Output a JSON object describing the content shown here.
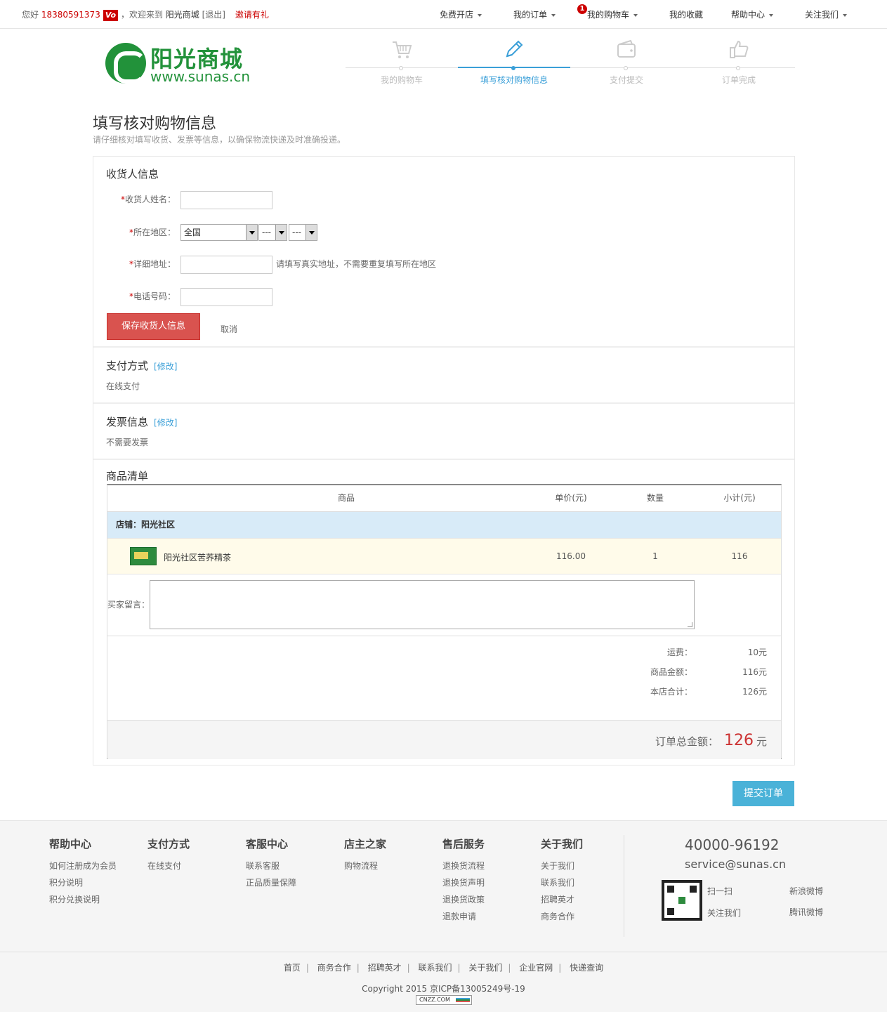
{
  "topbar": {
    "greeting": "您好",
    "phone": "18380591373",
    "vip_badge": "Vo",
    "welcome": "，欢迎来到",
    "site_name": "阳光商城",
    "logout": "[退出]",
    "invite": "邀请有礼",
    "nav": [
      {
        "label": "免费开店",
        "caret": true
      },
      {
        "label": "我的订单",
        "caret": true
      },
      {
        "label": "我的购物车",
        "caret": true,
        "badge": "1"
      },
      {
        "label": "我的收藏",
        "caret": false
      },
      {
        "label": "帮助中心",
        "caret": true
      },
      {
        "label": "关注我们",
        "caret": true
      }
    ]
  },
  "logo": {
    "zh": "阳光商城",
    "en": "www.sunas.cn"
  },
  "steps": [
    {
      "label": "我的购物车",
      "icon": "cart-icon",
      "active": false
    },
    {
      "label": "填写核对购物信息",
      "icon": "pencil-icon",
      "active": true
    },
    {
      "label": "支付提交",
      "icon": "wallet-icon",
      "active": false
    },
    {
      "label": "订单完成",
      "icon": "thumbs-up-icon",
      "active": false
    }
  ],
  "page": {
    "title": "填写核对购物信息",
    "subtitle": "请仔细核对填写收货、发票等信息，以确保物流快递及时准确投递。"
  },
  "receiver": {
    "heading": "收货人信息",
    "required_mark": "*",
    "name_label": "收货人姓名：",
    "region_label": "所在地区：",
    "region_values": [
      "全国",
      "---",
      "---"
    ],
    "address_label": "详细地址：",
    "address_hint": "请填写真实地址，不需要重复填写所在地区",
    "phone_label": "电话号码：",
    "save_label": "保存收货人信息",
    "cancel_label": "取消"
  },
  "payment": {
    "heading": "支付方式",
    "modify": "[修改]",
    "value": "在线支付"
  },
  "invoice": {
    "heading": "发票信息",
    "modify": "[修改]",
    "value": "不需要发票"
  },
  "goods": {
    "heading": "商品清单",
    "columns": [
      "商品",
      "单价(元)",
      "数量",
      "小计(元)"
    ],
    "shop": "店铺：阳光社区",
    "items": [
      {
        "name": "阳光社区苦荞精茶",
        "price": "116.00",
        "qty": "1",
        "subtotal": "116"
      }
    ],
    "message_label": "买家留言：",
    "summary": [
      {
        "label": "运费：",
        "value": "10元"
      },
      {
        "label": "商品金额：",
        "value": "116元"
      },
      {
        "label": "本店合计：",
        "value": "126元"
      }
    ],
    "total_label": "订单总金额：",
    "total_value": "126",
    "total_unit": "元"
  },
  "submit_label": "提交订单",
  "footer": {
    "columns": [
      {
        "title": "帮助中心",
        "links": [
          "如何注册成为会员",
          "积分说明",
          "积分兑换说明"
        ]
      },
      {
        "title": "支付方式",
        "links": [
          "在线支付"
        ]
      },
      {
        "title": "客服中心",
        "links": [
          "联系客服",
          "正品质量保障"
        ]
      },
      {
        "title": "店主之家",
        "links": [
          "购物流程"
        ]
      },
      {
        "title": "售后服务",
        "links": [
          "退换货流程",
          "退换货声明",
          "退换货政策",
          "退款申请"
        ]
      },
      {
        "title": "关于我们",
        "links": [
          "关于我们",
          "联系我们",
          "招聘英才",
          "商务合作"
        ]
      }
    ],
    "hotline": "40000-96192",
    "email": "service@sunas.cn",
    "scan": "扫一扫",
    "follow": "关注我们",
    "weibo_sina": "新浪微博",
    "weibo_tencent": "腾讯微博",
    "bottom_links": [
      "首页",
      "商务合作",
      "招聘英才",
      "联系我们",
      "关于我们",
      "企业官网",
      "快递查询"
    ],
    "copyright": "Copyright 2015 京ICP备13005249号-19",
    "cnzz": "CNZZ.COM"
  },
  "colors": {
    "accent": "#3a9fd8",
    "brand_green": "#22923a",
    "danger": "#d9534f",
    "price_red": "#cc3333"
  }
}
